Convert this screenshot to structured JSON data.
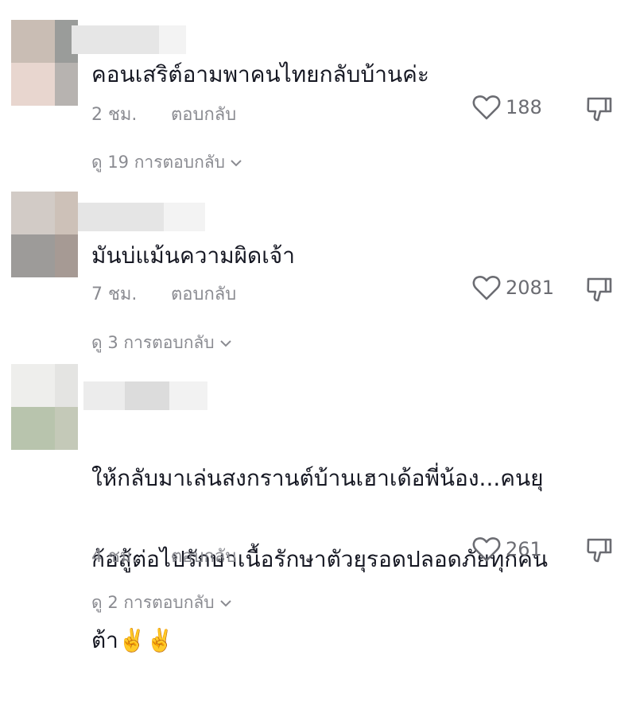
{
  "comments": [
    {
      "text": "คอนเสริต์อามพาคนไทยกลับบ้านค่ะ",
      "time": "2 ชม.",
      "reply_label": "ตอบกลับ",
      "likes": "188",
      "view_replies": "ดู 19 การตอบกลับ"
    },
    {
      "text": "มันบ่แม้นความผิดเจ้า",
      "time": "7 ชม.",
      "reply_label": "ตอบกลับ",
      "likes": "2081",
      "view_replies": "ดู 3 การตอบกลับ"
    },
    {
      "text_line1": "ให้กลับมาเล่นสงกรานต์บ้านเฮาเด้อพี่น้อง...คนยุ",
      "text_line2": "ก้อสู้ต่อไปรักษาเนื้อรักษาตัวยุรอดปลอดภัยทุกคน",
      "text_line3": "ต้า✌️✌️",
      "time": "4 ชม.",
      "reply_label": "ตอบกลับ",
      "likes": "261",
      "view_replies": "ดู 2 การตอบกลับ"
    }
  ],
  "icons": {
    "like": "heart-outline-icon",
    "dislike": "thumbs-down-icon",
    "expand": "chevron-down-icon"
  },
  "colors": {
    "text": "#161823",
    "secondary": "#8a8b91",
    "icon": "#6b6c72"
  }
}
